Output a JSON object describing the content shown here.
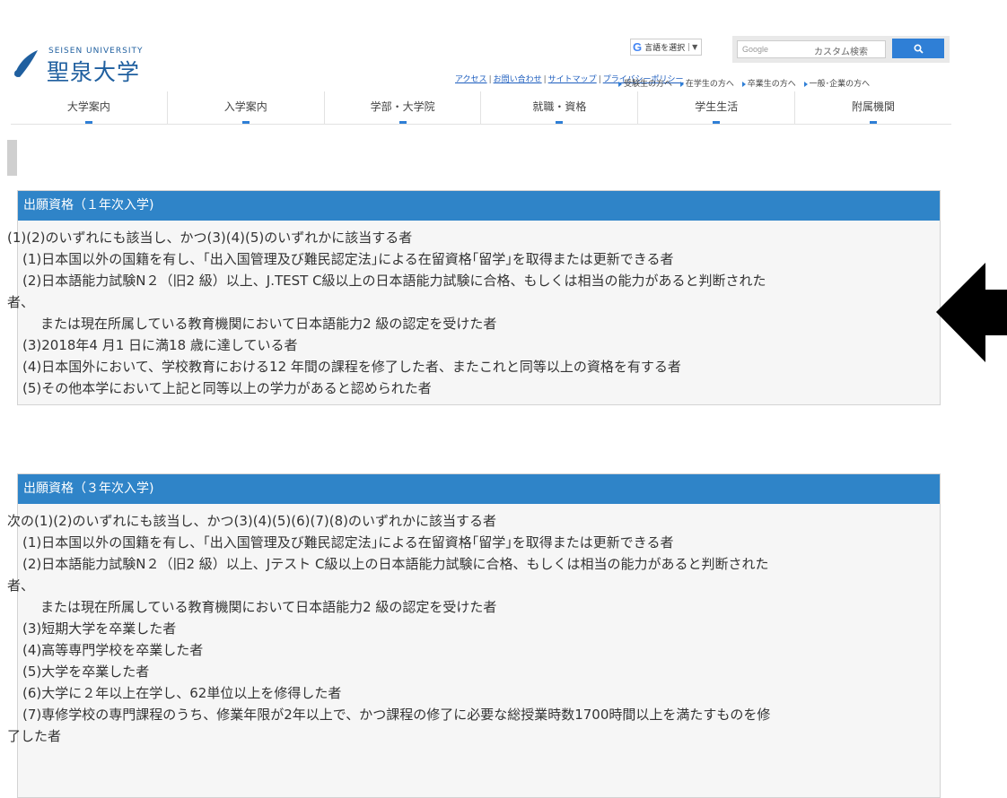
{
  "logo": {
    "en": "SEISEN UNIVERSITY",
    "jp": "聖泉大学"
  },
  "toplinks": [
    "アクセス",
    "お問い合わせ",
    "サイトマップ",
    "プライバシーポリシー"
  ],
  "translate": {
    "g": "G",
    "label": "言語を選択",
    "caret": "▼"
  },
  "search": {
    "placeholder": "Google",
    "label": "カスタム検索",
    "button_icon": "search-icon"
  },
  "sublinks": [
    "受験生の方へ",
    "在学生の方へ",
    "卒業生の方へ",
    "一般･企業の方へ"
  ],
  "nav": [
    "大学案内",
    "入学案内",
    "学部・大学院",
    "就職・資格",
    "学生生活",
    "附属機関"
  ],
  "section1": {
    "heading": "出願資格（１年次入学)",
    "lines": [
      "(1)(2)のいずれにも該当し、かつ(3)(4)(5)のいずれかに該当する者",
      "(1)日本国以外の国籍を有し、｢出入国管理及び難民認定法｣による在留資格｢留学｣を取得または更新できる者",
      "(2)日本語能力試験N２（旧2 級）以上、J.TEST C級以上の日本語能力試験に合格、もしくは相当の能力があると判断された",
      "者、",
      "または現在所属している教育機関において日本語能力2 級の認定を受けた者",
      "(3)2018年4 月1 日に満18 歳に達している者",
      "(4)日本国外において、学校教育における12 年間の課程を修了した者、またこれと同等以上の資格を有する者",
      "(5)その他本学において上記と同等以上の学力があると認められた者"
    ]
  },
  "section2": {
    "heading": "出願資格（３年次入学)",
    "lines": [
      "次の(1)(2)のいずれにも該当し、かつ(3)(4)(5)(6)(7)(8)のいずれかに該当する者",
      "(1)日本国以外の国籍を有し、｢出入国管理及び難民認定法｣による在留資格｢留学｣を取得または更新できる者",
      "(2)日本語能力試験N２（旧2 級）以上、Jテスト C級以上の日本語能力試験に合格、もしくは相当の能力があると判断された",
      "者、",
      "または現在所属している教育機関において日本語能力2 級の認定を受けた者",
      "(3)短期大学を卒業した者",
      "(4)高等専門学校を卒業した者",
      "(5)大学を卒業した者",
      "(6)大学に２年以上在学し、62単位以上を修得した者",
      "(7)専修学校の専門課程のうち、修業年限が2年以上で、かつ課程の修了に必要な総授業時数1700時間以上を満たすものを修",
      "了した者"
    ]
  },
  "colors": {
    "accent": "#2f84c8",
    "brand": "#1f5f9f",
    "arrow": "#000000"
  },
  "overlay": {
    "icon": "left-arrow-icon"
  }
}
